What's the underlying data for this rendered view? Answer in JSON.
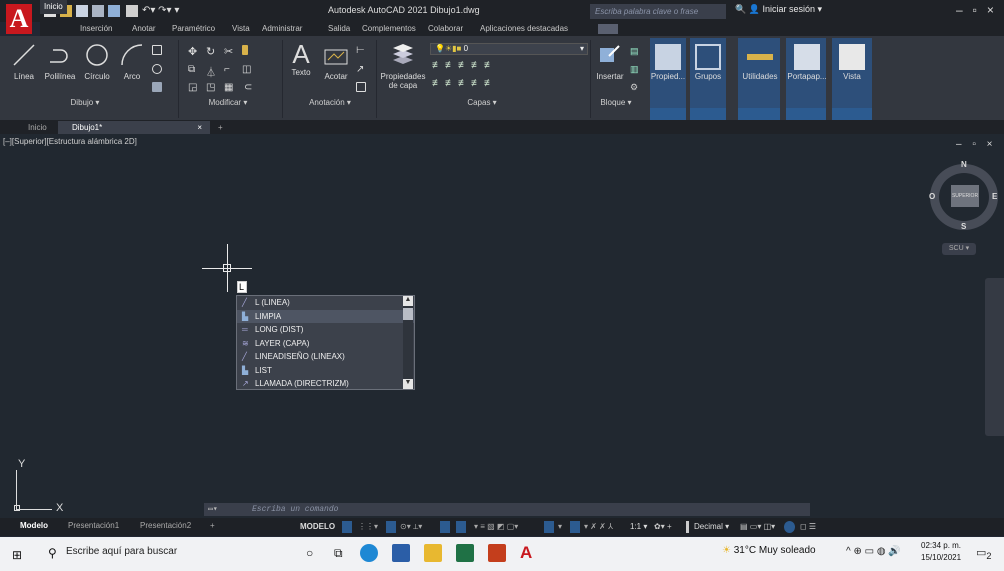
{
  "app": {
    "title": "Autodesk AutoCAD 2021   Dibujo1.dwg",
    "search_placeholder": "Escriba palabra clave o frase",
    "signin": "Iniciar sesión",
    "logo": "A"
  },
  "ribbon_tabs": [
    "Inicio",
    "Inserción",
    "Anotar",
    "Paramétrico",
    "Vista",
    "Administrar",
    "Salida",
    "Complementos",
    "Colaborar",
    "Aplicaciones destacadas"
  ],
  "ribbon": {
    "draw": {
      "line": "Línea",
      "polyline": "Polilínea",
      "circle": "Círculo",
      "arc": "Arco",
      "panel": "Dibujo ▾"
    },
    "modify": {
      "panel": "Modificar ▾"
    },
    "annotation": {
      "text": "Texto",
      "dim": "Acotar",
      "panel": "Anotación ▾"
    },
    "layers": {
      "props_line1": "Propiedades",
      "props_line2": "de capa",
      "current_layer": "0",
      "panel": "Capas ▾"
    },
    "block": {
      "insert": "Insertar",
      "panel": "Bloque ▾"
    },
    "props": "Propied...",
    "groups": "Grupos",
    "utilities": "Utilidades",
    "clipboard": "Portapap...",
    "view": "Vista"
  },
  "file_tabs": {
    "start": "Inicio",
    "drawing": "Dibujo1*",
    "close": "×",
    "new": "+"
  },
  "viewport_label": "[–][Superior][Estructura alámbrica 2D]",
  "viewport_controls": "– ▫ ×",
  "navcube": {
    "n": "N",
    "s": "S",
    "e": "E",
    "o": "O",
    "face": "SUPERIOR",
    "ucs": "SCU ▾"
  },
  "autocomplete": {
    "typed": "L",
    "items": [
      {
        "label": "L (LINEA)",
        "icon": "line-icon"
      },
      {
        "label": "LIMPIA",
        "icon": "purge-icon"
      },
      {
        "label": "LONG (DIST)",
        "icon": "dist-icon"
      },
      {
        "label": "LAYER (CAPA)",
        "icon": "layer-icon"
      },
      {
        "label": "LINEADISEÑO (LINEAX)",
        "icon": "xline-icon"
      },
      {
        "label": "LIST",
        "icon": "list-icon"
      },
      {
        "label": "LLAMADA (DIRECTRIZM)",
        "icon": "leader-icon"
      }
    ]
  },
  "ucs": {
    "y": "Y",
    "x": "X"
  },
  "command_line": {
    "placeholder": "Escriba un comando"
  },
  "layout_tabs": [
    "Modelo",
    "Presentación1",
    "Presentación2",
    "+"
  ],
  "status": {
    "model": "MODELO",
    "scale": "1:1 ▾",
    "units": "Decimal ▾"
  },
  "taskbar": {
    "search": "Escribe aquí para buscar",
    "weather": "31°C  Muy soleado",
    "time": "02:34 p. m.",
    "date": "15/10/2021",
    "notif_count": "2"
  },
  "colors": {
    "accent": "#2c5b90",
    "logo": "#c8181e",
    "drawing_bg": "#212830"
  }
}
